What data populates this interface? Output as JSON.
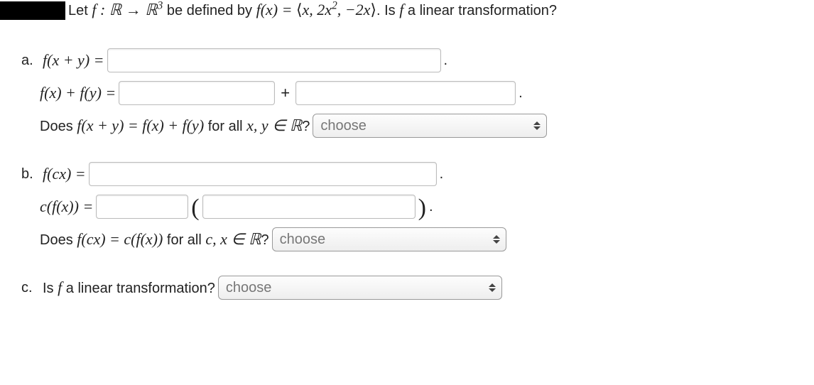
{
  "prompt": {
    "pre": "Let ",
    "fmap": "f : ℝ → ℝ",
    "sup": "3",
    "mid": " be defined by ",
    "fx": "f(x) = ",
    "tuple_open": "⟨",
    "tuple_inner": "x, 2x",
    "tuple_sup": "2",
    "tuple_rest": ", −2x",
    "tuple_close": "⟩",
    "post": ". Is ",
    "fvar": "f",
    "tail": " a linear transformation?"
  },
  "a": {
    "marker": "a.",
    "line1_lhs": "f(x + y) =",
    "line1_period": ".",
    "line2_lhs": "f(x) + f(y) =",
    "plus": "+",
    "line2_period": ".",
    "q_pre": "Does ",
    "q_math1": "f(x + y) = f(x) + f(y)",
    "q_mid": " for all ",
    "q_math2": "x, y ∈ ℝ",
    "q_post": "?",
    "choose": "choose"
  },
  "b": {
    "marker": "b.",
    "line1_lhs": "f(cx) =",
    "line1_period": ".",
    "line2_lhs": "c(f(x)) =",
    "lparen": "(",
    "rparen": ")",
    "line2_period": ".",
    "q_pre": "Does ",
    "q_math1": "f(cx) = c(f(x))",
    "q_mid": " for all ",
    "q_math2": "c, x ∈ ℝ",
    "q_post": "?",
    "choose": "choose"
  },
  "c": {
    "marker": "c.",
    "q_pre": "Is ",
    "fvar": "f",
    "q_post": " a linear transformation?",
    "choose": "choose"
  }
}
